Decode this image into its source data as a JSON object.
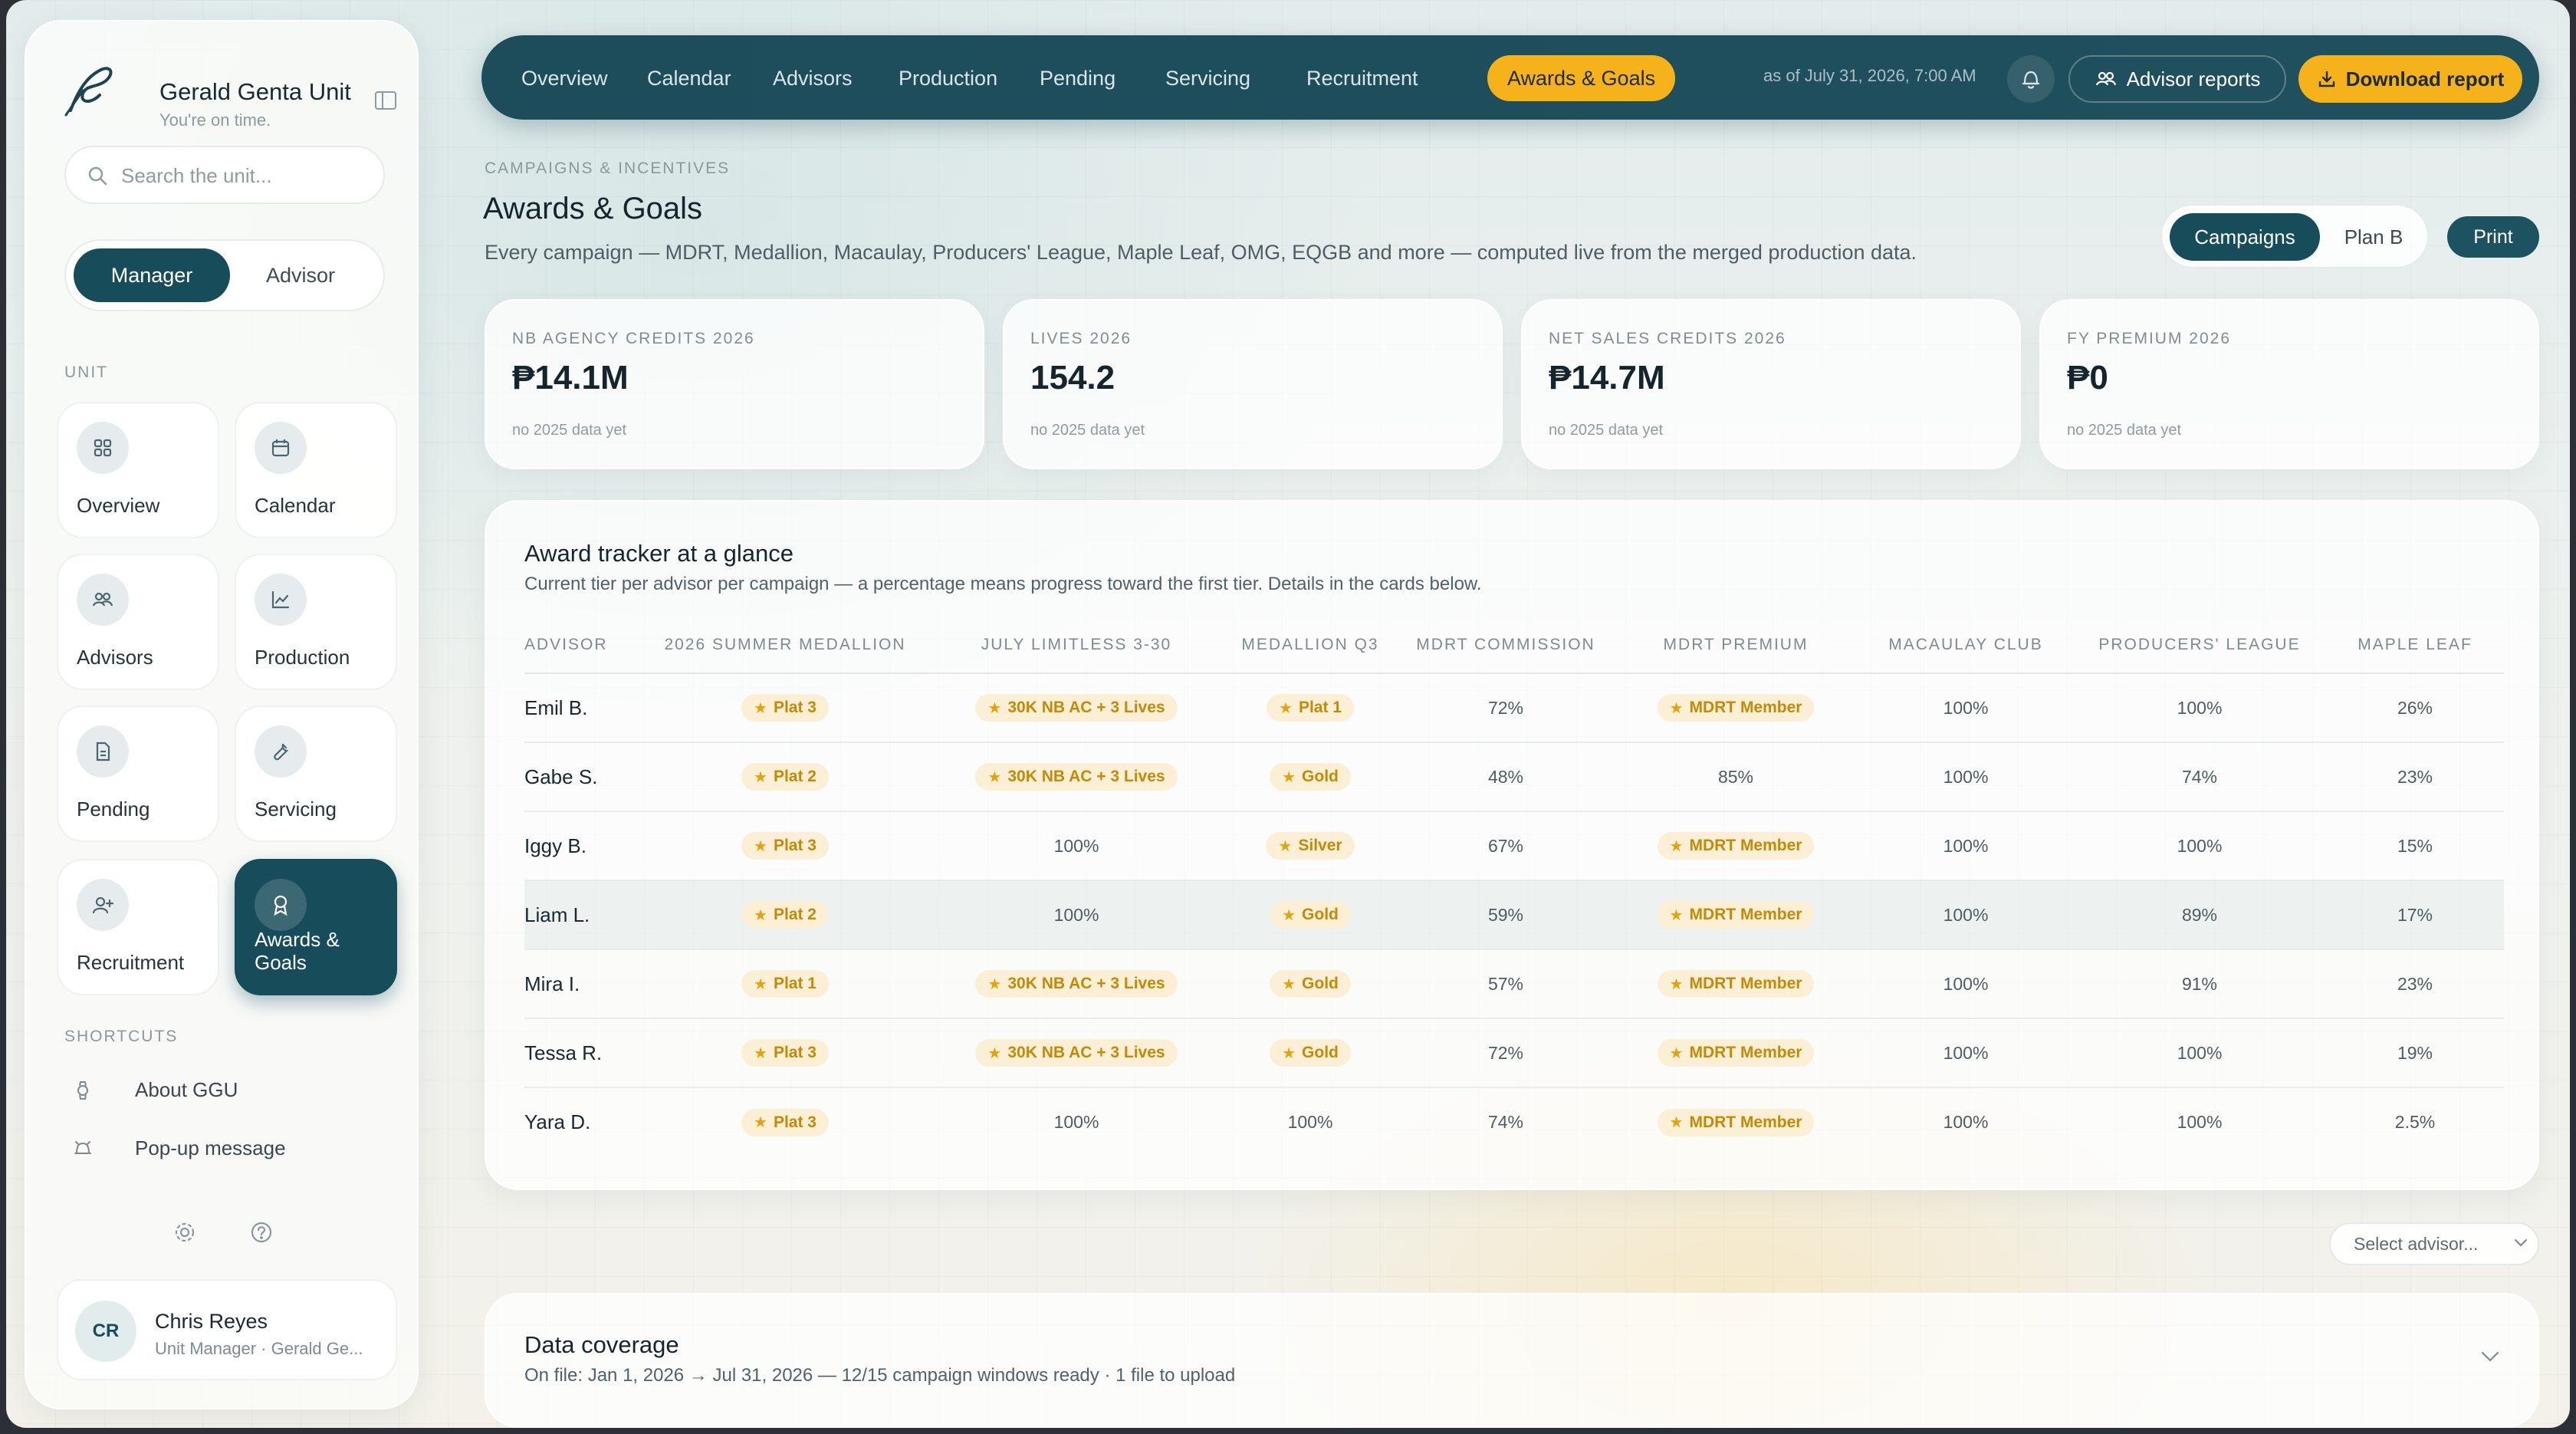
{
  "sidebar": {
    "brand_title": "Gerald Genta Unit",
    "brand_subtitle": "You're on time.",
    "search_placeholder": "Search the unit...",
    "roles": [
      "Manager",
      "Advisor"
    ],
    "active_role": "Manager",
    "section_unit": "UNIT",
    "nav": [
      {
        "label": "Overview",
        "icon": "grid-icon"
      },
      {
        "label": "Calendar",
        "icon": "calendar-icon"
      },
      {
        "label": "Advisors",
        "icon": "users-icon"
      },
      {
        "label": "Production",
        "icon": "chart-icon"
      },
      {
        "label": "Pending",
        "icon": "document-icon"
      },
      {
        "label": "Servicing",
        "icon": "wrench-icon"
      },
      {
        "label": "Recruitment",
        "icon": "add-user-icon"
      },
      {
        "label": "Awards & Goals",
        "icon": "award-icon"
      }
    ],
    "active_nav": "Awards & Goals",
    "section_shortcuts": "SHORTCUTS",
    "shortcuts": [
      {
        "label": "About GGU",
        "icon": "watch-icon"
      },
      {
        "label": "Pop-up message",
        "icon": "alarm-icon"
      }
    ],
    "user": {
      "initials": "CR",
      "name": "Chris Reyes",
      "role": "Unit Manager · Gerald Ge..."
    }
  },
  "topnav": {
    "tabs": [
      "Overview",
      "Calendar",
      "Advisors",
      "Production",
      "Pending",
      "Servicing",
      "Recruitment",
      "Awards & Goals"
    ],
    "active_tab": "Awards & Goals",
    "as_of": "as of July 31, 2026, 7:00 AM",
    "advisor_reports_label": "Advisor reports",
    "download_label": "Download report"
  },
  "header": {
    "eyebrow": "CAMPAIGNS & INCENTIVES",
    "title": "Awards & Goals",
    "description": "Every campaign — MDRT, Medallion, Macaulay, Producers' League, Maple Leaf, OMG, EQGB and more — computed live from the merged production data.",
    "view_options": [
      "Campaigns",
      "Plan B"
    ],
    "active_view": "Campaigns",
    "print_label": "Print"
  },
  "kpis": [
    {
      "label": "NB AGENCY CREDITS 2026",
      "value": "₱14.1M",
      "note": "no 2025 data yet"
    },
    {
      "label": "LIVES 2026",
      "value": "154.2",
      "note": "no 2025 data yet"
    },
    {
      "label": "NET SALES CREDITS 2026",
      "value": "₱14.7M",
      "note": "no 2025 data yet"
    },
    {
      "label": "FY PREMIUM 2026",
      "value": "₱0",
      "note": "no 2025 data yet"
    }
  ],
  "tracker": {
    "title": "Award tracker at a glance",
    "subtitle": "Current tier per advisor per campaign — a percentage means progress toward the first tier. Details in the cards below.",
    "columns": [
      "ADVISOR",
      "2026 SUMMER MEDALLION",
      "JULY LIMITLESS 3-30",
      "MEDALLION Q3",
      "MDRT COMMISSION",
      "MDRT PREMIUM",
      "MACAULAY CLUB",
      "PRODUCERS' LEAGUE",
      "MAPLE LEAF"
    ],
    "rows": [
      {
        "advisor": "Emil B.",
        "highlight": false,
        "cells": [
          {
            "t": "Plat 3",
            "b": true
          },
          {
            "t": "30K NB AC + 3 Lives",
            "b": true
          },
          {
            "t": "Plat 1",
            "b": true
          },
          {
            "t": "72%",
            "b": false
          },
          {
            "t": "MDRT Member",
            "b": true
          },
          {
            "t": "100%",
            "b": false
          },
          {
            "t": "100%",
            "b": false
          },
          {
            "t": "26%",
            "b": false
          }
        ]
      },
      {
        "advisor": "Gabe S.",
        "highlight": false,
        "cells": [
          {
            "t": "Plat 2",
            "b": true
          },
          {
            "t": "30K NB AC + 3 Lives",
            "b": true
          },
          {
            "t": "Gold",
            "b": true
          },
          {
            "t": "48%",
            "b": false
          },
          {
            "t": "85%",
            "b": false
          },
          {
            "t": "100%",
            "b": false
          },
          {
            "t": "74%",
            "b": false
          },
          {
            "t": "23%",
            "b": false
          }
        ]
      },
      {
        "advisor": "Iggy B.",
        "highlight": false,
        "cells": [
          {
            "t": "Plat 3",
            "b": true
          },
          {
            "t": "100%",
            "b": false
          },
          {
            "t": "Silver",
            "b": true
          },
          {
            "t": "67%",
            "b": false
          },
          {
            "t": "MDRT Member",
            "b": true
          },
          {
            "t": "100%",
            "b": false
          },
          {
            "t": "100%",
            "b": false
          },
          {
            "t": "15%",
            "b": false
          }
        ]
      },
      {
        "advisor": "Liam L.",
        "highlight": true,
        "cells": [
          {
            "t": "Plat 2",
            "b": true
          },
          {
            "t": "100%",
            "b": false
          },
          {
            "t": "Gold",
            "b": true
          },
          {
            "t": "59%",
            "b": false
          },
          {
            "t": "MDRT Member",
            "b": true
          },
          {
            "t": "100%",
            "b": false
          },
          {
            "t": "89%",
            "b": false
          },
          {
            "t": "17%",
            "b": false
          }
        ]
      },
      {
        "advisor": "Mira I.",
        "highlight": false,
        "cells": [
          {
            "t": "Plat 1",
            "b": true
          },
          {
            "t": "30K NB AC + 3 Lives",
            "b": true
          },
          {
            "t": "Gold",
            "b": true
          },
          {
            "t": "57%",
            "b": false
          },
          {
            "t": "MDRT Member",
            "b": true
          },
          {
            "t": "100%",
            "b": false
          },
          {
            "t": "91%",
            "b": false
          },
          {
            "t": "23%",
            "b": false
          }
        ]
      },
      {
        "advisor": "Tessa R.",
        "highlight": false,
        "cells": [
          {
            "t": "Plat 3",
            "b": true
          },
          {
            "t": "30K NB AC + 3 Lives",
            "b": true
          },
          {
            "t": "Gold",
            "b": true
          },
          {
            "t": "72%",
            "b": false
          },
          {
            "t": "MDRT Member",
            "b": true
          },
          {
            "t": "100%",
            "b": false
          },
          {
            "t": "100%",
            "b": false
          },
          {
            "t": "19%",
            "b": false
          }
        ]
      },
      {
        "advisor": "Yara D.",
        "highlight": false,
        "cells": [
          {
            "t": "Plat 3",
            "b": true
          },
          {
            "t": "100%",
            "b": false
          },
          {
            "t": "100%",
            "b": false
          },
          {
            "t": "74%",
            "b": false
          },
          {
            "t": "MDRT Member",
            "b": true
          },
          {
            "t": "100%",
            "b": false
          },
          {
            "t": "100%",
            "b": false
          },
          {
            "t": "2.5%",
            "b": false
          }
        ]
      }
    ]
  },
  "select_advisor": {
    "placeholder": "Select advisor..."
  },
  "coverage": {
    "title": "Data coverage",
    "subtitle": "On file: Jan 1, 2026 → Jul 31, 2026 — 12/15 campaign windows ready · 1 file to upload"
  },
  "colors": {
    "primary": "#174c5a",
    "accent": "#f6b21b",
    "badge_bg": "#fbf0d6",
    "badge_text": "#c48a07"
  }
}
